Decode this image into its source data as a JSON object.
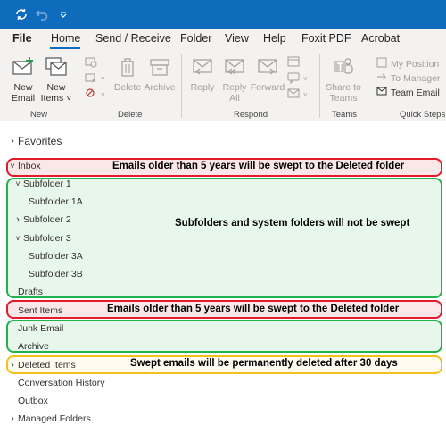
{
  "ribbon_tabs": [
    "File",
    "Home",
    "Send / Receive",
    "Folder",
    "View",
    "Help",
    "Foxit PDF",
    "Acrobat"
  ],
  "ribbon": {
    "new_email": "New Email",
    "new_email_line1": "New",
    "new_email_line2": "Email",
    "new_items_line1": "New",
    "new_items_line2": "Items",
    "group_new": "New",
    "delete": "Delete",
    "archive": "Archive",
    "group_delete": "Delete",
    "reply": "Reply",
    "reply_all_line1": "Reply",
    "reply_all_line2": "All",
    "forward": "Forward",
    "group_respond": "Respond",
    "share_line1": "Share to",
    "share_line2": "Teams",
    "group_teams": "Teams",
    "quick_steps": [
      "My Position",
      "To Manager",
      "Team Email"
    ],
    "group_quick_steps": "Quick Steps"
  },
  "folders": {
    "favorites": "Favorites",
    "inbox": "Inbox",
    "subfolder_1": "Subfolder 1",
    "subfolder_1a": "Subfolder 1A",
    "subfolder_2": "Subfolder 2",
    "subfolder_3": "Subfolder 3",
    "subfolder_3a": "Subfolder 3A",
    "subfolder_3b": "Subfolder 3B",
    "drafts": "Drafts",
    "sent_items": "Sent Items",
    "junk_email": "Junk Email",
    "archive": "Archive",
    "deleted_items": "Deleted Items",
    "conversation_history": "Conversation History",
    "outbox": "Outbox",
    "managed_folders": "Managed Folders"
  },
  "annotations": {
    "inbox_note": "Emails older than 5 years will be swept to the Deleted folder",
    "subfolders_note": "Subfolders and system folders will not be swept",
    "sent_note": "Emails older than 5 years will be swept to the Deleted folder",
    "deleted_note": "Swept emails will be permanently deleted after 30 days"
  },
  "colors": {
    "titlebar": "#0f6cbd",
    "red_box": "#e21b2d",
    "green_box": "#22b14c",
    "yellow_box": "#f3c01c"
  }
}
